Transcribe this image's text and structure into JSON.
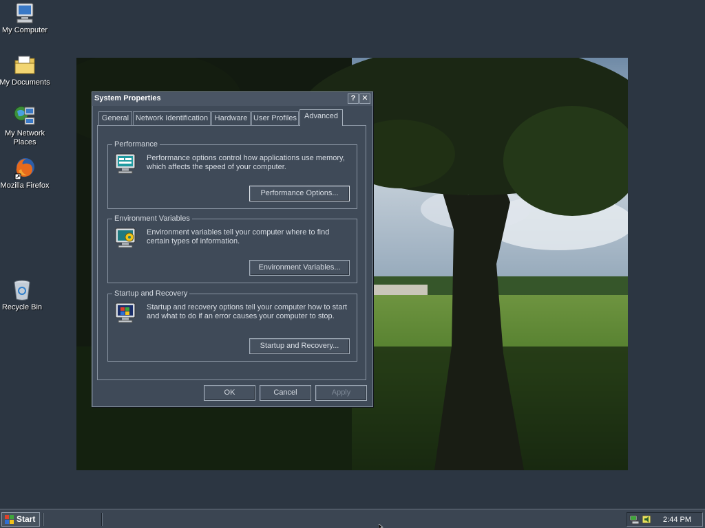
{
  "desktop": {
    "icons": [
      {
        "label": "My Computer",
        "icon": "my-computer-icon"
      },
      {
        "label": "My Documents",
        "icon": "my-documents-icon"
      },
      {
        "label": "My Network Places",
        "icon": "network-places-icon"
      },
      {
        "label": "Mozilla Firefox",
        "icon": "firefox-icon"
      },
      {
        "label": "Recycle Bin",
        "icon": "recycle-bin-icon"
      }
    ]
  },
  "dialog": {
    "title": "System Properties",
    "help_button": "?",
    "close_button": "✕",
    "tabs": [
      {
        "label": "General",
        "active": false
      },
      {
        "label": "Network Identification",
        "active": false
      },
      {
        "label": "Hardware",
        "active": false
      },
      {
        "label": "User Profiles",
        "active": false
      },
      {
        "label": "Advanced",
        "active": true
      }
    ],
    "groups": [
      {
        "title": "Performance",
        "description": "Performance options control how applications use memory, which affects the speed of your computer.",
        "button": "Performance Options...",
        "icon": "monitor-performance-icon"
      },
      {
        "title": "Environment Variables",
        "description": "Environment variables tell your computer where to find certain types of information.",
        "button": "Environment Variables...",
        "icon": "monitor-settings-icon"
      },
      {
        "title": "Startup and Recovery",
        "description": "Startup and recovery options tell your computer how to start and what to do if an error causes your computer to stop.",
        "button": "Startup and Recovery...",
        "icon": "monitor-startup-icon"
      }
    ],
    "buttons": {
      "ok": "OK",
      "cancel": "Cancel",
      "apply": "Apply"
    }
  },
  "taskbar": {
    "start_label": "Start",
    "clock": "2:44 PM"
  },
  "colors": {
    "desktop": "#2c3642",
    "dialog_face": "#3f4a58",
    "title_bar": "#4a5564",
    "text": "#d8dde4"
  }
}
